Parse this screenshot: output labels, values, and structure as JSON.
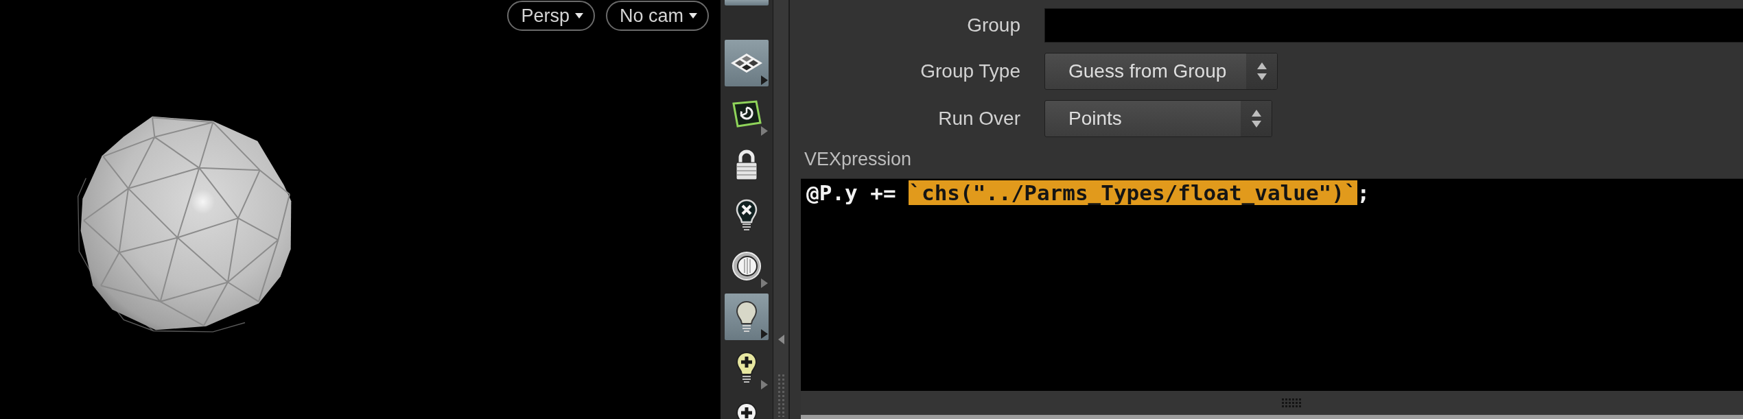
{
  "viewport": {
    "menus": [
      {
        "label": "Persp"
      },
      {
        "label": "No cam"
      }
    ]
  },
  "toolbar": {
    "tools": [
      {
        "selected": true
      },
      {
        "selected": true
      },
      {
        "selected": false
      },
      {
        "selected": false
      },
      {
        "selected": false
      },
      {
        "selected": false
      },
      {
        "selected": true
      },
      {
        "selected": false
      },
      {
        "selected": false
      }
    ]
  },
  "parameters": {
    "rows": [
      {
        "kind": "field",
        "label": "Group"
      },
      {
        "kind": "menu",
        "label": "Group Type",
        "value": "Guess from Group"
      },
      {
        "kind": "menu",
        "label": "Run Over",
        "value": "Points"
      }
    ]
  },
  "vexpression": {
    "label": "VEXpression",
    "code": [
      {
        "text": "@P.y += ",
        "selected": false
      },
      {
        "text": "`chs(\"../Parms_Types/float_value\")`",
        "selected": true
      },
      {
        "text": ";",
        "selected": false
      }
    ]
  }
}
